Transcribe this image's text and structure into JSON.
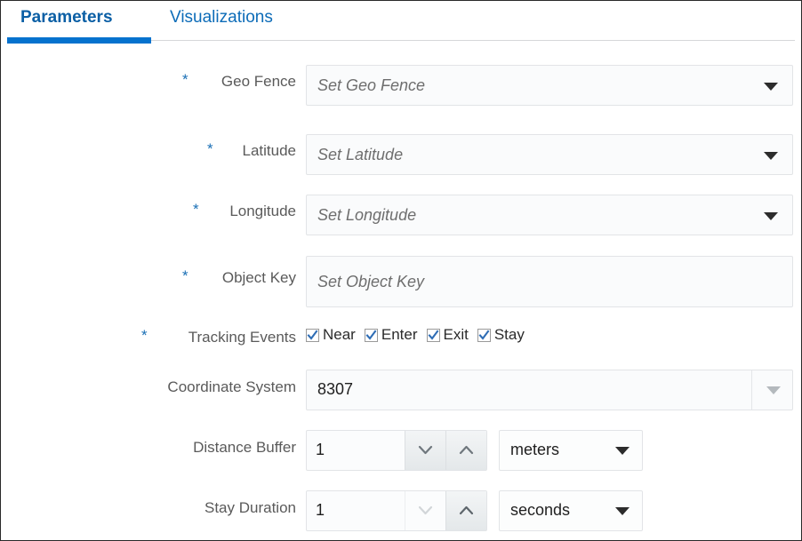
{
  "tabs": [
    {
      "label": "Parameters",
      "active": true
    },
    {
      "label": "Visualizations",
      "active": false
    }
  ],
  "form": {
    "geo_fence": {
      "label": "Geo Fence",
      "required_marker": "*",
      "placeholder": "Set Geo Fence",
      "value": ""
    },
    "latitude": {
      "label": "Latitude",
      "required_marker": "*",
      "placeholder": "Set Latitude",
      "value": ""
    },
    "longitude": {
      "label": "Longitude",
      "required_marker": "*",
      "placeholder": "Set Longitude",
      "value": ""
    },
    "object_key": {
      "label": "Object Key",
      "required_marker": "*",
      "placeholder": "Set Object Key",
      "value": ""
    },
    "tracking_events": {
      "label": "Tracking Events",
      "required_marker": "*",
      "options": [
        {
          "label": "Near",
          "checked": true
        },
        {
          "label": "Enter",
          "checked": true
        },
        {
          "label": "Exit",
          "checked": true
        },
        {
          "label": "Stay",
          "checked": true
        }
      ]
    },
    "coordinate_system": {
      "label": "Coordinate System",
      "value": "8307"
    },
    "distance_buffer": {
      "label": "Distance Buffer",
      "value": "1",
      "unit": "meters",
      "decrement_enabled": true,
      "increment_enabled": true
    },
    "stay_duration": {
      "label": "Stay Duration",
      "value": "1",
      "unit": "seconds",
      "decrement_enabled": false,
      "increment_enabled": true
    }
  },
  "colors": {
    "accent_blue": "#0572ce",
    "tab_text_blue": "#0d6cb8",
    "required_star": "#1a6fb5",
    "label_gray": "#5a5a5a",
    "placeholder_gray": "#6e6e6e",
    "field_border": "#e2e4e7",
    "field_bg": "#fafbfc",
    "check_blue": "#2f6db5"
  }
}
